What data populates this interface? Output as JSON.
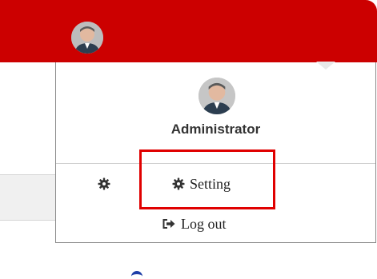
{
  "header": {
    "user_avatar_icon": "user-avatar",
    "color": "#cc0000"
  },
  "user_menu": {
    "name": "Administrator",
    "avatar_icon": "user-avatar",
    "items": [
      {
        "label": "Setting",
        "icon": "gear-icon"
      },
      {
        "label": "Log out",
        "icon": "sign-out-icon"
      }
    ],
    "highlight_color": "#e00000"
  }
}
